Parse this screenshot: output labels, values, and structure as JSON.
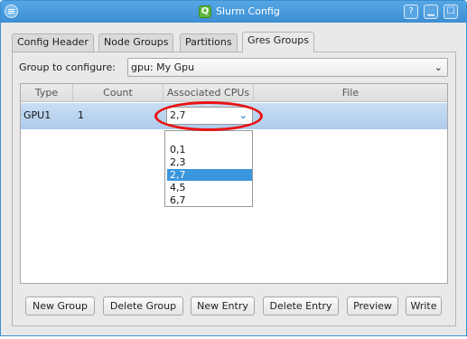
{
  "window": {
    "title": "Slurm Config",
    "app_icon": "Q",
    "controls": {
      "menu": "menu-icon",
      "help": "?",
      "minimize": "▁",
      "maximize": "☐",
      "close": "✕"
    }
  },
  "tabs": [
    {
      "label": "Config Header",
      "active": false
    },
    {
      "label": "Node Groups",
      "active": false
    },
    {
      "label": "Partitions",
      "active": false
    },
    {
      "label": "Gres Groups",
      "active": true
    }
  ],
  "group": {
    "label": "Group to configure:",
    "selected": "gpu: My Gpu"
  },
  "table": {
    "headers": [
      "Type",
      "Count",
      "Associated CPUs",
      "File"
    ],
    "rows": [
      {
        "type": "GPU1",
        "count": "1",
        "cpus": "2,7",
        "file": ""
      }
    ]
  },
  "dropdown": {
    "options": [
      "",
      "0,1",
      "2,3",
      "2,7",
      "4,5",
      "6,7"
    ],
    "selected_index": 3
  },
  "buttons": {
    "new_group": "New Group",
    "delete_group": "Delete Group",
    "new_entry": "New Entry",
    "delete_entry": "Delete Entry",
    "preview": "Preview",
    "write": "Write"
  },
  "colors": {
    "titlebar": "#3d8fd3",
    "selection": "#3a96dd",
    "annotation": "#ea1111"
  }
}
